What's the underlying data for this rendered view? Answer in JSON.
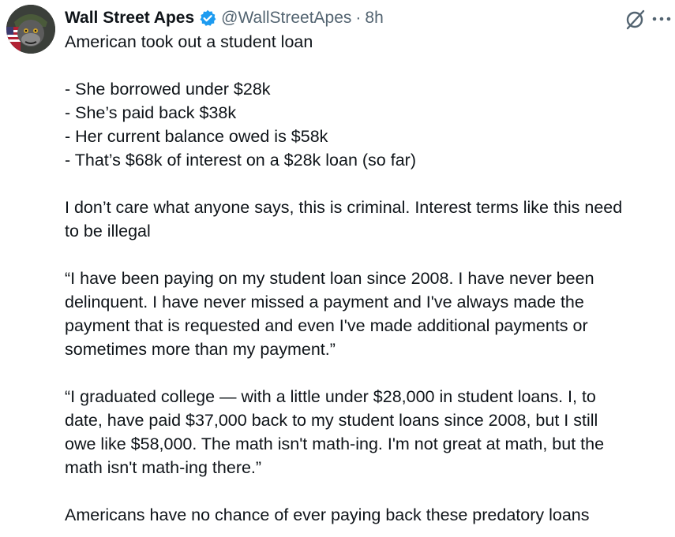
{
  "author": {
    "display_name": "Wall Street Apes",
    "handle": "@WallStreetApes",
    "separator": "·",
    "time": "8h",
    "verified_color": "#1d9bf0"
  },
  "icons": {
    "verified": "verified-badge-icon",
    "grok": "grok-icon",
    "more": "more-icon"
  },
  "tweet": {
    "intro": "American took out a student loan",
    "bullets": [
      "- She borrowed under $28k",
      "- She’s paid back $38k",
      "- Her current balance owed is $58k",
      "- That’s $68k of interest on a $28k loan (so far)"
    ],
    "opinion": [
      "I don’t care what anyone says, this is criminal. Interest terms like this need",
      "to be illegal"
    ],
    "quote1": [
      "“I have been paying on my student loan since 2008. I have never been",
      "delinquent. I have never missed a payment and I've always made the",
      "payment that is requested and even I've made additional payments or",
      "sometimes more than my payment.”"
    ],
    "quote2": [
      "“I graduated college — with a little under $28,000 in student loans.  I, to",
      "date, have paid $37,000 back to my student loans since 2008, but I still",
      "owe like $58,000. The math isn't math-ing. I'm not great at math, but the",
      "math isn't math-ing there.”"
    ],
    "closing": "Americans have no chance of ever paying back these predatory loans"
  }
}
